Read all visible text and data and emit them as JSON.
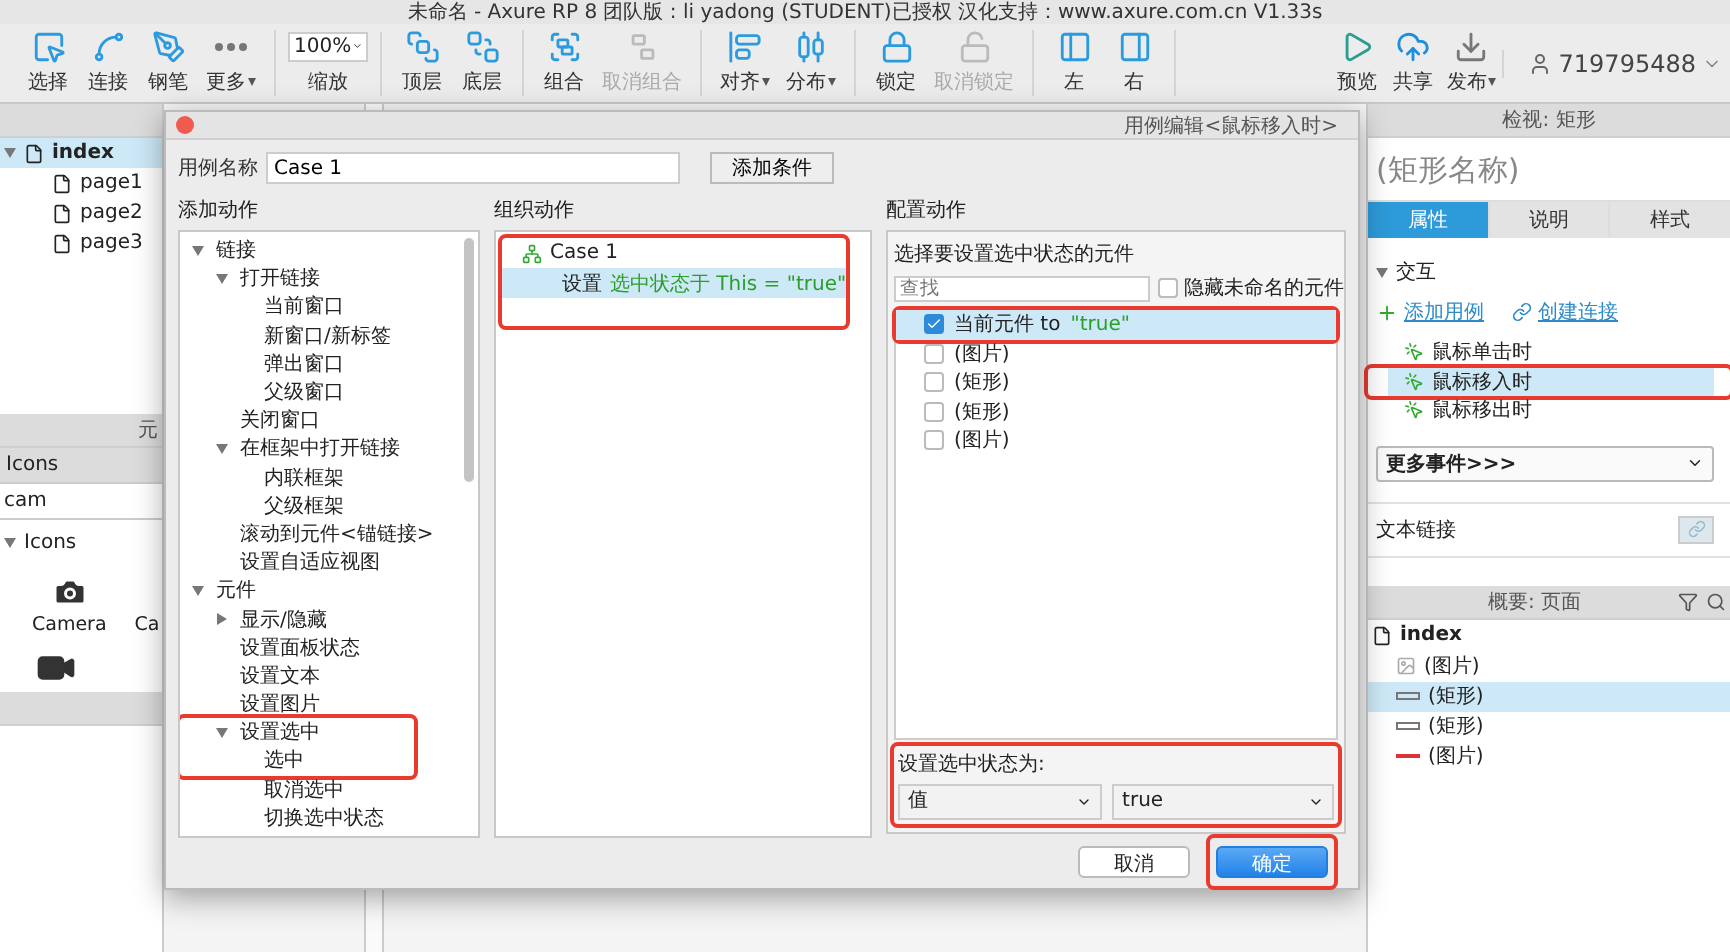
{
  "window": {
    "title": "未命名 - Axure RP 8 团队版 : li yadong (STUDENT)已授权 汉化支持：www.axure.com.cn V1.33s"
  },
  "toolbar": {
    "groups": [
      [
        {
          "kind": "tool",
          "label": "选择",
          "disabled": false,
          "has_menu": false
        },
        {
          "kind": "tool",
          "label": "连接",
          "disabled": false,
          "has_menu": false
        },
        {
          "kind": "tool",
          "label": "钢笔",
          "disabled": false,
          "has_menu": false
        },
        {
          "kind": "tool",
          "label": "更多",
          "disabled": false,
          "has_menu": true
        }
      ],
      [
        {
          "kind": "zoom",
          "label": "缩放",
          "value": "100%"
        }
      ],
      [
        {
          "kind": "tool",
          "label": "顶层",
          "disabled": false,
          "has_menu": false
        },
        {
          "kind": "tool",
          "label": "底层",
          "disabled": false,
          "has_menu": false
        }
      ],
      [
        {
          "kind": "tool",
          "label": "组合",
          "disabled": false,
          "has_menu": false
        },
        {
          "kind": "tool",
          "label": "取消组合",
          "disabled": true,
          "has_menu": false
        }
      ],
      [
        {
          "kind": "tool",
          "label": "对齐",
          "disabled": false,
          "has_menu": true
        },
        {
          "kind": "tool",
          "label": "分布",
          "disabled": false,
          "has_menu": true
        }
      ],
      [
        {
          "kind": "tool",
          "label": "锁定",
          "disabled": false,
          "has_menu": false
        },
        {
          "kind": "tool",
          "label": "取消锁定",
          "disabled": true,
          "has_menu": false
        }
      ],
      [
        {
          "kind": "tool",
          "label": "左",
          "disabled": false,
          "has_menu": false
        },
        {
          "kind": "tool",
          "label": "右",
          "disabled": false,
          "has_menu": false
        }
      ]
    ],
    "right_tools": [
      {
        "label": "预览",
        "has_menu": false
      },
      {
        "label": "共享",
        "has_menu": false
      },
      {
        "label": "发布",
        "has_menu": true
      }
    ],
    "user": "719795488"
  },
  "pages": {
    "items": [
      {
        "name": "index",
        "selected": true,
        "expanded": true,
        "children": [
          {
            "name": "page1",
            "selected": false
          },
          {
            "name": "page2",
            "selected": false
          },
          {
            "name": "page3",
            "selected": false
          }
        ]
      }
    ]
  },
  "library": {
    "title": "元",
    "dropdown": "Icons",
    "search": "cam",
    "group": {
      "name": "Icons",
      "expanded": true
    },
    "items": [
      "Camera",
      "Ca"
    ]
  },
  "dialog": {
    "title": "用例编辑<鼠标移入时>",
    "case_label": "用例名称",
    "case_name": "Case 1",
    "add_condition": "添加条件",
    "add_actions": {
      "title": "添加动作",
      "tree": [
        {
          "label": "链接",
          "expanded": true,
          "highlighted": false,
          "children": [
            {
              "label": "打开链接",
              "expanded": true,
              "highlighted": false,
              "children": [
                {
                  "label": "当前窗口",
                  "highlighted": false
                },
                {
                  "label": "新窗口/新标签",
                  "highlighted": false
                },
                {
                  "label": "弹出窗口",
                  "highlighted": false
                },
                {
                  "label": "父级窗口",
                  "highlighted": false
                }
              ]
            },
            {
              "label": "关闭窗口",
              "highlighted": false
            },
            {
              "label": "在框架中打开链接",
              "expanded": true,
              "highlighted": false,
              "children": [
                {
                  "label": "内联框架",
                  "highlighted": false
                },
                {
                  "label": "父级框架",
                  "highlighted": false
                }
              ]
            },
            {
              "label": "滚动到元件<锚链接>",
              "highlighted": false
            },
            {
              "label": "设置自适应视图",
              "highlighted": false
            }
          ]
        },
        {
          "label": "元件",
          "expanded": true,
          "highlighted": false,
          "children": [
            {
              "label": "显示/隐藏",
              "expanded": false,
              "highlighted": false
            },
            {
              "label": "设置面板状态",
              "highlighted": false
            },
            {
              "label": "设置文本",
              "highlighted": false
            },
            {
              "label": "设置图片",
              "highlighted": false
            },
            {
              "label": "设置选中",
              "expanded": true,
              "highlighted": true,
              "children": [
                {
                  "label": "选中",
                  "highlighted": true
                },
                {
                  "label": "取消选中",
                  "highlighted": false
                },
                {
                  "label": "切换选中状态",
                  "highlighted": false
                }
              ]
            }
          ]
        }
      ]
    },
    "organize": {
      "title": "组织动作",
      "highlighted": true,
      "case": "Case 1",
      "actions": [
        {
          "verb": "设置",
          "target": "选中状态于 This = \"true\"",
          "selected": true
        }
      ]
    },
    "configure": {
      "title": "配置动作",
      "prompt": "选择要设置选中状态的元件",
      "search_placeholder": "查找",
      "hide_unnamed": {
        "label": "隐藏未命名的元件",
        "checked": false
      },
      "widgets": [
        {
          "name": "当前元件 to",
          "value": "\"true\"",
          "checked": true,
          "selected": true,
          "highlighted": true
        },
        {
          "name": "(图片)",
          "checked": false,
          "selected": false,
          "highlighted": false
        },
        {
          "name": "(矩形)",
          "checked": false,
          "selected": false,
          "highlighted": false
        },
        {
          "name": "(矩形)",
          "checked": false,
          "selected": false,
          "highlighted": false
        },
        {
          "name": "(图片)",
          "checked": false,
          "selected": false,
          "highlighted": false
        }
      ],
      "state_highlighted": true,
      "state_label": "设置选中状态为:",
      "mode": "值",
      "value": "true"
    },
    "buttons": [
      {
        "label": "取消",
        "primary": false,
        "highlighted": false
      },
      {
        "label": "确定",
        "primary": true,
        "highlighted": true
      }
    ]
  },
  "inspector": {
    "title": "检视: 矩形",
    "name_placeholder": "(矩形名称)",
    "tabs": [
      {
        "label": "属性",
        "selected": true
      },
      {
        "label": "说明",
        "selected": false
      },
      {
        "label": "样式",
        "selected": false
      }
    ],
    "section": {
      "label": "交互",
      "expanded": true
    },
    "links": [
      "添加用例",
      "创建连接"
    ],
    "events": [
      {
        "label": "鼠标单击时",
        "selected": false,
        "highlighted": false
      },
      {
        "label": "鼠标移入时",
        "selected": true,
        "highlighted": true
      },
      {
        "label": "鼠标移出时",
        "selected": false,
        "highlighted": false
      }
    ],
    "more_events": "更多事件>>>",
    "text_link": "文本链接"
  },
  "outline": {
    "title": "概要: 页面",
    "root": "index",
    "items": [
      {
        "label": "(图片)",
        "kind": "image",
        "selected": false
      },
      {
        "label": "(矩形)",
        "kind": "rect",
        "selected": true
      },
      {
        "label": "(矩形)",
        "kind": "rect",
        "selected": false
      },
      {
        "label": "(图片)",
        "kind": "line",
        "selected": false
      }
    ]
  }
}
